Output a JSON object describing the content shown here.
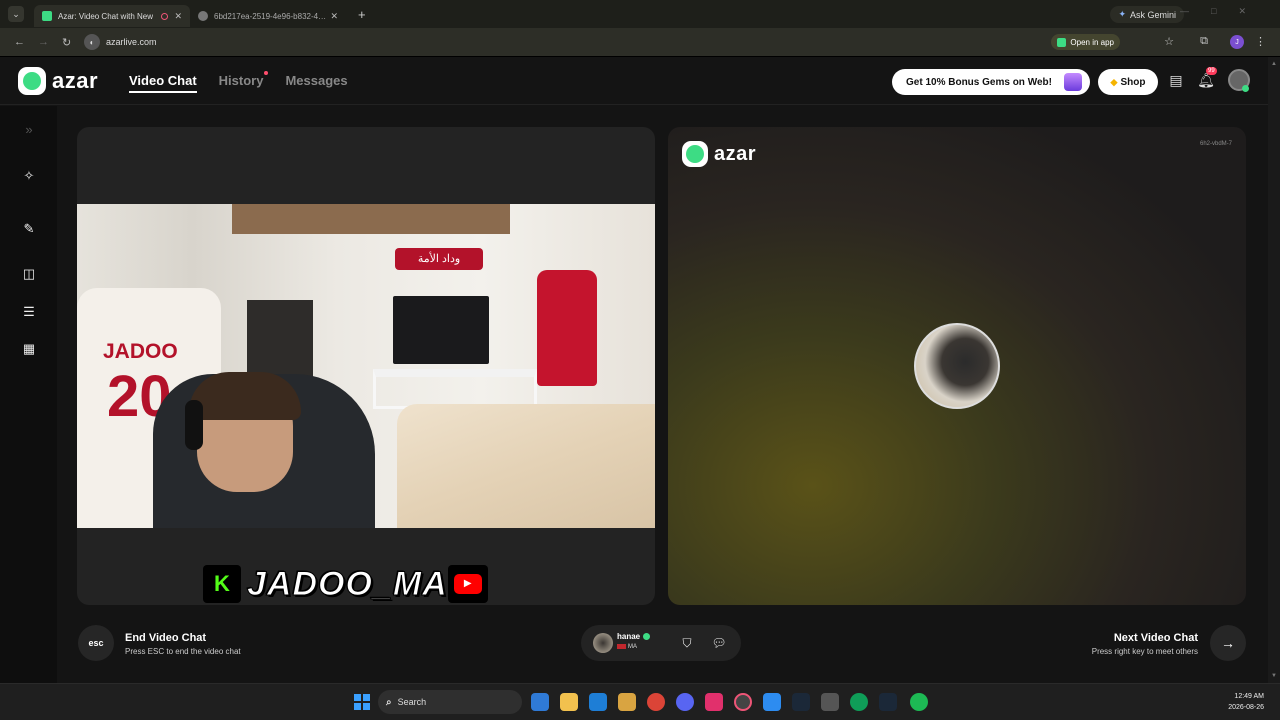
{
  "browser": {
    "tabs": [
      {
        "title": "Azar: Video Chat with New",
        "active": true
      },
      {
        "title": "6bd217ea-2519-4e96-b832-4…",
        "active": false
      }
    ],
    "ask_gemini": "Ask Gemini",
    "url": "azarlive.com",
    "open_in_app": "Open in app",
    "profile_initial": "J"
  },
  "header": {
    "logo_text": "azar",
    "nav": [
      {
        "label": "Video Chat",
        "active": true
      },
      {
        "label": "History",
        "active": false,
        "has_dot": true
      },
      {
        "label": "Messages",
        "active": false
      }
    ],
    "bonus_label": "Get 10% Bonus Gems on Web!",
    "shop_label": "Shop",
    "notification_count": "99"
  },
  "left_pane": {
    "jersey_name": "JADOO",
    "jersey_number": "20",
    "banner_text": "وداد الأمة",
    "streamer_kick_letter": "K",
    "streamer_name": "JADOO_MA"
  },
  "right_pane": {
    "watermark": "azar",
    "tag": "6h2-vbdM-7"
  },
  "controls": {
    "esc_key": "esc",
    "end_title": "End Video Chat",
    "end_sub": "Press ESC to end the video chat",
    "peer_name": "hanae",
    "peer_country": "MA",
    "next_title": "Next Video Chat",
    "next_sub": "Press right key to meet others"
  },
  "taskbar": {
    "search_label": "Search",
    "time": "12:49 AM",
    "date": "2026-08-26"
  },
  "colors": {
    "accent_green": "#3ddc84",
    "background": "#141414",
    "kick_green": "#53fc18",
    "youtube_red": "#ff0000"
  }
}
